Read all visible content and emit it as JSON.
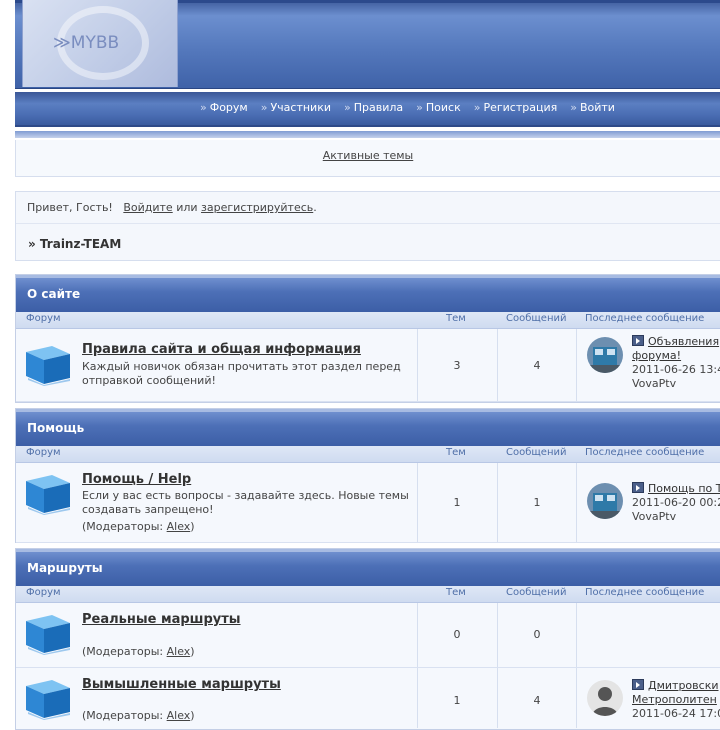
{
  "header": {
    "logo_text": "≫MYBB"
  },
  "nav": {
    "items": [
      {
        "label": "Форум"
      },
      {
        "label": "Участники"
      },
      {
        "label": "Правила"
      },
      {
        "label": "Поиск"
      },
      {
        "label": "Регистрация"
      },
      {
        "label": "Войти"
      }
    ]
  },
  "active_topics": "Активные темы",
  "welcome": {
    "greeting": "Привет, Гость!",
    "login": "Войдите",
    "or": "или",
    "register": "зарегистрируйтесь",
    "dot": ".",
    "breadcrumb": "» Trainz-TEAM"
  },
  "columns": {
    "forum": "Форум",
    "topics": "Тем",
    "posts": "Сообщений",
    "last_post": "Последнее сообщение"
  },
  "categories": [
    {
      "title": "О сайте",
      "forums": [
        {
          "title": "Правила сайта и общая информация",
          "desc": "Каждый новичок обязан прочитать этот раздел перед отправкой сообщений!",
          "moderators_label": "",
          "moderator": "",
          "topics": "3",
          "posts": "4",
          "last_title": "Объявления",
          "last_title2": "форума!",
          "last_date": "2011-06-26 13:4",
          "last_user": "VovaPtv"
        }
      ]
    },
    {
      "title": "Помощь",
      "forums": [
        {
          "title": "Помощь / Help",
          "desc": "Если у вас есть вопросы - задавайте здесь. Новые темы создавать запрещено!",
          "moderators_label": "(Модераторы: ",
          "moderator": "Alex",
          "topics": "1",
          "posts": "1",
          "last_title": "Помощь по T",
          "last_date": "2011-06-20 00:2",
          "last_user": "VovaPtv"
        }
      ]
    },
    {
      "title": "Маршруты",
      "forums": [
        {
          "title": "Реальные маршруты",
          "desc": "",
          "moderators_label": "(Модераторы: ",
          "moderator": "Alex",
          "topics": "0",
          "posts": "0"
        },
        {
          "title": "Вымышленные маршруты",
          "desc": "",
          "moderators_label": "(Модераторы: ",
          "moderator": "Alex",
          "topics": "1",
          "posts": "4",
          "last_title": "Дмитровски",
          "last_title2": "Метрополитен",
          "last_date": "2011-06-24 17:0"
        }
      ]
    }
  ],
  "closing_paren": ")"
}
